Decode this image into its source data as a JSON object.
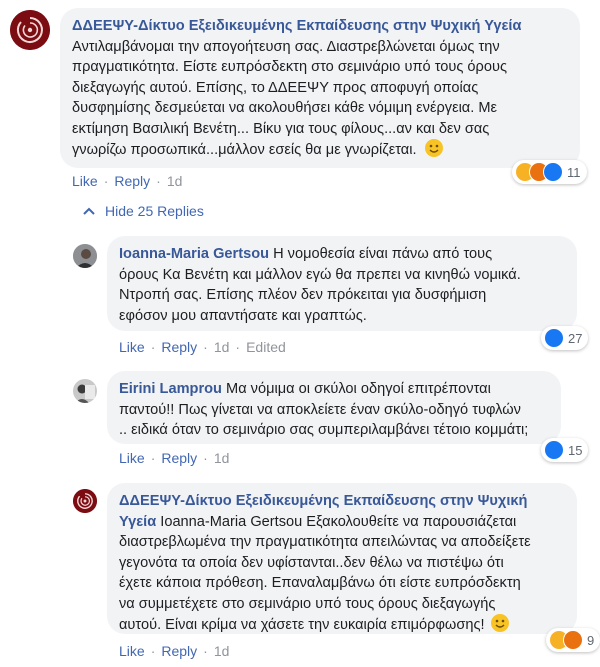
{
  "comments": [
    {
      "author": "ΔΔΕΕΨΥ-Δίκτυο Εξειδικευμένης Εκπαίδευσης στην Ψυχική Υγεία",
      "lines": [
        "Αντιλαμβάνομαι την απογοήτευση σας. Διαστρεβλώνεται όμως την",
        "πραγματικότητα. Είστε ευπρόσδεκτη στο σεμινάριο υπό τους όρους",
        "διεξαγωγής αυτού. Επίσης, το ΔΔΕΕΨΥ προς αποφυγή οποίας",
        "δυσφημίσης δεσμεύεται να ακολουθήσει κάθε νόμιμη ενέργεια. Με",
        "εκτίμηση Βασιλική Βενέτη... Βίκυ για τους φίλους...αν και δεν σας",
        "γνωρίζω προσωπικά...μάλλον εσείς θα με γνωρίζεται."
      ],
      "like": "Like",
      "reply": "Reply",
      "time": "1d",
      "reaction_count": "11",
      "reactions": [
        "haha-icon",
        "angry-icon",
        "like-icon"
      ]
    },
    {
      "author": "Ioanna-Maria Gertsou",
      "first_line": " Η νομοθεσία είναι πάνω από τους",
      "lines": [
        "όρους Κα Βενέτη και μάλλον εγώ θα πρεπει να κινηθώ νομικά.",
        "Ντροπή σας. Επίσης πλέον δεν πρόκειται για δυσφήμιση",
        "εφόσον μου απαντήσατε και γραπτώς."
      ],
      "like": "Like",
      "reply": "Reply",
      "time": "1d",
      "edited": "Edited",
      "reaction_count": "27",
      "reactions": [
        "like-icon"
      ]
    },
    {
      "author": "Eirini Lamprou",
      "first_line": " Μα νόμιμα οι σκύλοι οδηγοί επιτρέπονται",
      "lines": [
        "παντού!! Πως γίνεται να αποκλείετε έναν σκύλο-οδηγό τυφλών",
        ".. ειδικά όταν το σεμινάριο σας συμπεριλαμβάνει τέτοιο κομμάτι;"
      ],
      "like": "Like",
      "reply": "Reply",
      "time": "1d",
      "reaction_count": "15",
      "reactions": [
        "like-icon"
      ]
    },
    {
      "author_line1": "ΔΔΕΕΨΥ-Δίκτυο Εξειδικευμένης Εκπαίδευσης στην Ψυχική",
      "author_line2": "Υγεία",
      "first_line": " Ioanna-Maria Gertsou Εξακολουθείτε να παρουσιάζεται",
      "lines": [
        "διαστρεβλωμένα την πραγματικότητα απειλώντας να αποδείξετε",
        "γεγονότα τα οποία δεν υφίστανται..δεν θέλω να πιστέψω ότι",
        "έχετε κάποια πρόθεση. Επαναλαμβάνω ότι είστε ευπρόσδεκτη",
        "να συμμετέχετε στο σεμινάριο υπό τους όρους διεξαγωγής",
        "αυτού. Είναι κρίμα να χάσετε την ευκαιρία επιμόρφωσης!"
      ],
      "like": "Like",
      "reply": "Reply",
      "time": "1d",
      "reaction_count": "9",
      "reactions": [
        "haha-icon",
        "angry-icon"
      ]
    }
  ],
  "hide_replies": "Hide 25 Replies",
  "colors": {
    "link": "#385898",
    "bubble": "#f2f3f5",
    "action": "#4267b2",
    "like_blue": "#1877f2",
    "haha_yellow": "#f7b125",
    "angry_orange": "#e9710f"
  }
}
